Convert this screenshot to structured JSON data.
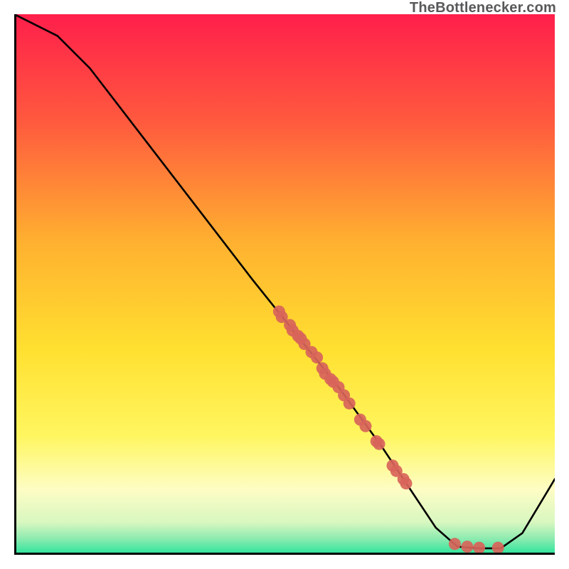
{
  "attribution": "TheBottlenecker.com",
  "colors": {
    "top": "#ff1f4b",
    "mid_upper": "#ffb030",
    "mid": "#ffe030",
    "mid_lower": "#fff860",
    "cream": "#fdfdc5",
    "green": "#28e49b",
    "scatter_fill": "#d8645a",
    "scatter_stroke": "#b84c44",
    "line": "#000000"
  },
  "chart_data": {
    "type": "line",
    "title": "",
    "xlabel": "",
    "ylabel": "",
    "xlim": [
      0,
      100
    ],
    "ylim": [
      0,
      100
    ],
    "curve": [
      {
        "x": 0,
        "y": 100
      },
      {
        "x": 8,
        "y": 96
      },
      {
        "x": 14,
        "y": 90
      },
      {
        "x": 24,
        "y": 77
      },
      {
        "x": 34,
        "y": 64
      },
      {
        "x": 44,
        "y": 51
      },
      {
        "x": 52,
        "y": 41
      },
      {
        "x": 60,
        "y": 31
      },
      {
        "x": 68,
        "y": 20
      },
      {
        "x": 74,
        "y": 11
      },
      {
        "x": 78,
        "y": 5
      },
      {
        "x": 82,
        "y": 1.5
      },
      {
        "x": 86,
        "y": 1.2
      },
      {
        "x": 90,
        "y": 1.2
      },
      {
        "x": 94,
        "y": 4
      },
      {
        "x": 100,
        "y": 14
      }
    ],
    "scatter": [
      {
        "x": 49.0,
        "y": 45.0
      },
      {
        "x": 49.5,
        "y": 44.0
      },
      {
        "x": 51.0,
        "y": 42.5
      },
      {
        "x": 51.5,
        "y": 41.5
      },
      {
        "x": 52.5,
        "y": 40.5
      },
      {
        "x": 53.0,
        "y": 40.0
      },
      {
        "x": 53.7,
        "y": 39.0
      },
      {
        "x": 55.0,
        "y": 37.5
      },
      {
        "x": 56.0,
        "y": 36.5
      },
      {
        "x": 57.0,
        "y": 34.5
      },
      {
        "x": 57.5,
        "y": 33.5
      },
      {
        "x": 58.5,
        "y": 32.5
      },
      {
        "x": 59.0,
        "y": 32.0
      },
      {
        "x": 60.0,
        "y": 31.0
      },
      {
        "x": 61.0,
        "y": 29.5
      },
      {
        "x": 62.0,
        "y": 28.0
      },
      {
        "x": 64.0,
        "y": 25.0
      },
      {
        "x": 65.0,
        "y": 23.8
      },
      {
        "x": 67.0,
        "y": 21.0
      },
      {
        "x": 67.5,
        "y": 20.5
      },
      {
        "x": 70.0,
        "y": 16.5
      },
      {
        "x": 70.7,
        "y": 15.5
      },
      {
        "x": 72.0,
        "y": 14.0
      },
      {
        "x": 72.5,
        "y": 13.2
      },
      {
        "x": 81.5,
        "y": 2.0
      },
      {
        "x": 83.8,
        "y": 1.5
      },
      {
        "x": 86.0,
        "y": 1.3
      },
      {
        "x": 89.5,
        "y": 1.3
      }
    ]
  }
}
